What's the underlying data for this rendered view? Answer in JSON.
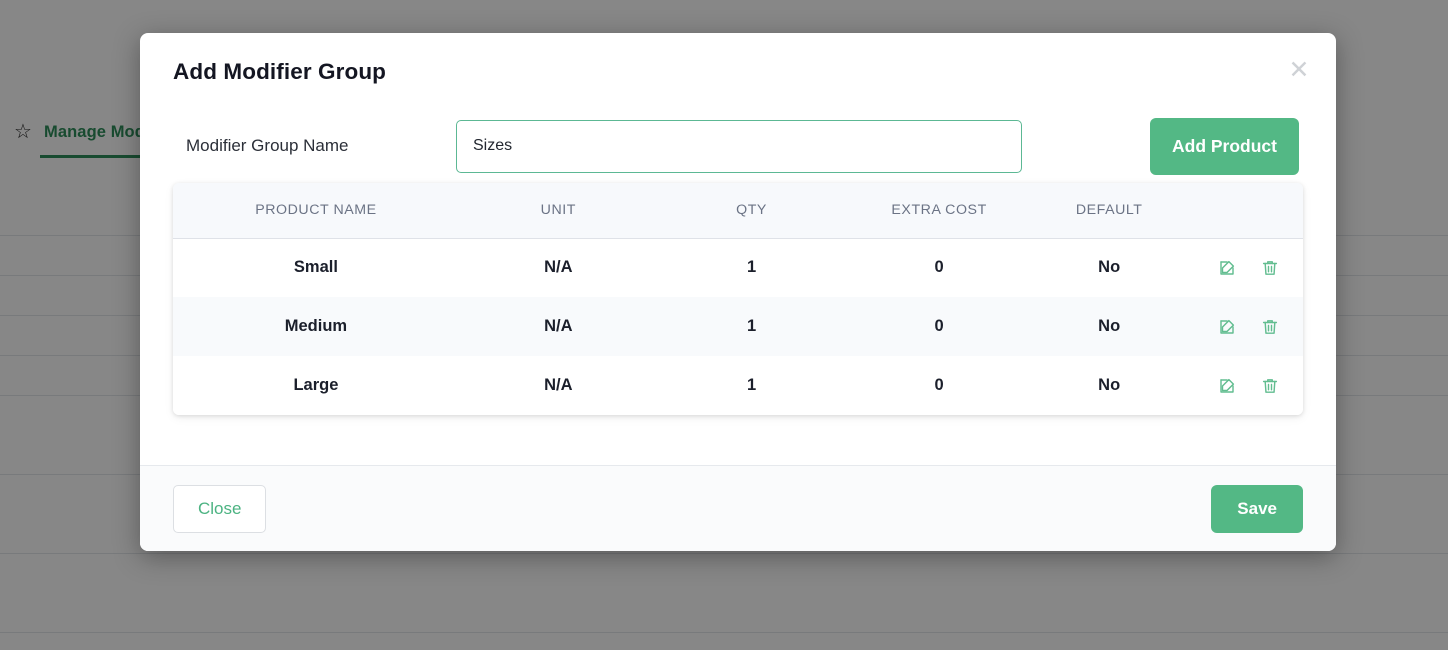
{
  "background": {
    "tab": {
      "star_icon": "star-icon",
      "label": "Manage Modifiers"
    }
  },
  "modal": {
    "title": "Add Modifier Group",
    "close_icon": "✕",
    "form": {
      "label": "Modifier Group Name",
      "value": "Sizes",
      "placeholder": "Modifier Group Name",
      "add_product_label": "Add Product"
    },
    "table": {
      "columns": [
        "PRODUCT NAME",
        "UNIT",
        "QTY",
        "EXTRA COST",
        "DEFAULT"
      ],
      "rows": [
        {
          "product_name": "Small",
          "unit": "N/A",
          "qty": "1",
          "extra_cost": "0",
          "default": "No"
        },
        {
          "product_name": "Medium",
          "unit": "N/A",
          "qty": "1",
          "extra_cost": "0",
          "default": "No"
        },
        {
          "product_name": "Large",
          "unit": "N/A",
          "qty": "1",
          "extra_cost": "0",
          "default": "No"
        }
      ],
      "row_actions": {
        "edit_icon": "edit-icon",
        "delete_icon": "trash-icon"
      }
    },
    "footer": {
      "close_label": "Close",
      "save_label": "Save"
    }
  },
  "colors": {
    "accent_green": "#53b885",
    "tab_green": "#2f8f5b",
    "icon_green": "#62bd90",
    "header_text": "#6b7385",
    "overlay": "rgba(0,0,0,0.47)"
  }
}
